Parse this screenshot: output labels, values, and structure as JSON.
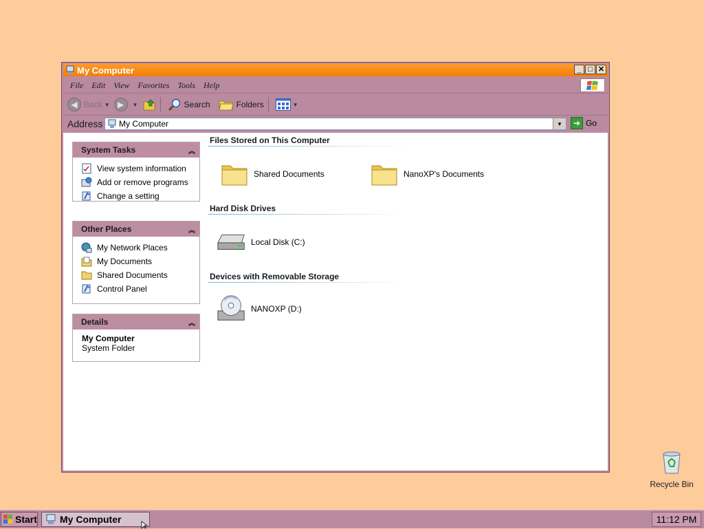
{
  "window": {
    "title": "My Computer",
    "buttons": {
      "minimize": "_",
      "maximize": "□",
      "close": "✕"
    }
  },
  "menu": [
    "File",
    "Edit",
    "View",
    "Favorites",
    "Tools",
    "Help"
  ],
  "toolbar": {
    "back": "Back",
    "search": "Search",
    "folders": "Folders"
  },
  "address": {
    "label": "Address",
    "value": "My Computer",
    "go": "Go"
  },
  "panes": {
    "system_tasks": {
      "title": "System Tasks",
      "items": [
        "View system information",
        "Add or remove programs",
        "Change a setting"
      ]
    },
    "other_places": {
      "title": "Other Places",
      "items": [
        "My Network Places",
        "My Documents",
        "Shared Documents",
        "Control Panel"
      ]
    },
    "details": {
      "title": "Details",
      "name": "My Computer",
      "type": "System Folder"
    }
  },
  "groups": {
    "files": {
      "title": "Files Stored on This Computer",
      "items": [
        "Shared Documents",
        "NanoXP's Documents"
      ]
    },
    "hdd": {
      "title": "Hard Disk Drives",
      "items": [
        "Local Disk (C:)"
      ]
    },
    "removable": {
      "title": "Devices with Removable Storage",
      "items": [
        "NANOXP (D:)"
      ]
    }
  },
  "desktop": {
    "recycle_bin": "Recycle Bin"
  },
  "taskbar": {
    "start": "Start",
    "task": "My Computer",
    "clock": "11:12 PM"
  },
  "colors": {
    "desktop": "#fecb9b",
    "chrome": "#b98aa0",
    "titlebar": "#f27f05"
  }
}
